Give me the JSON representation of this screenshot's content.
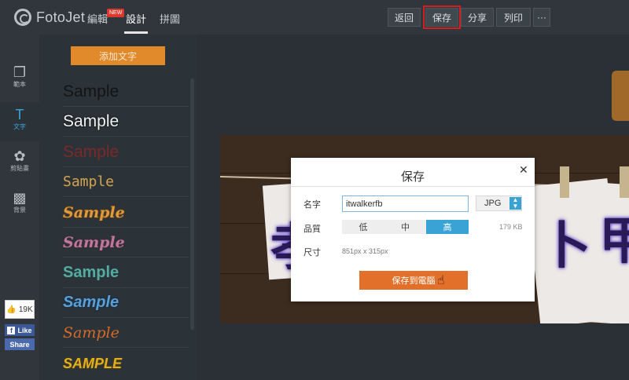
{
  "app": {
    "logo_text": "FotoJet"
  },
  "nav": {
    "items": [
      {
        "label": "編輯",
        "badge": "NEW"
      },
      {
        "label": "設計"
      },
      {
        "label": "拼圖"
      }
    ],
    "active_index": 1
  },
  "toolbar": {
    "back_label": "返回",
    "save_label": "保存",
    "share_label": "分享",
    "print_label": "列印",
    "more_label": "···"
  },
  "iconbar": {
    "items": [
      {
        "icon": "template-icon",
        "label": "範本"
      },
      {
        "icon": "text-icon",
        "label": "文字"
      },
      {
        "icon": "clipart-icon",
        "label": "剪貼畫"
      },
      {
        "icon": "background-icon",
        "label": "背景"
      }
    ],
    "active_index": 1
  },
  "social": {
    "likes_count": "19K",
    "like_label": "Like",
    "share_label": "Share"
  },
  "panel": {
    "add_text_label": "添加文字",
    "samples": [
      "Sample",
      "Sample",
      "Sample",
      "Sample",
      "Sample",
      "Sample",
      "Sample",
      "Sample",
      "Sample",
      "SAMPLE"
    ],
    "sample_colors": [
      "#141414",
      "#f2f2f2",
      "#7a2a2a",
      "#c9a15a",
      "#e09a3a",
      "#c0789a",
      "#5aa8a0",
      "#5aa0d6",
      "#d56a2a",
      "#e0b020"
    ]
  },
  "save_dialog": {
    "title": "保存",
    "close": "✕",
    "name_label": "名字",
    "name_value": "itwalkerfb",
    "format_value": "JPG",
    "quality_label": "品質",
    "quality_options": [
      "低",
      "中",
      "高"
    ],
    "quality_selected_index": 2,
    "file_size": "179 KB",
    "dimension_label": "尺寸",
    "dimension_value": "851px x 315px",
    "save_button_label": "保存到電腦"
  },
  "colors": {
    "accent": "#3aa3d6",
    "save_button": "#e2702a",
    "highlight_frame": "#d22020"
  }
}
